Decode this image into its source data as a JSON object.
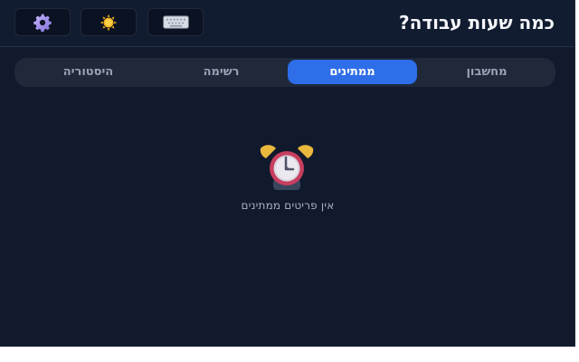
{
  "header": {
    "title": "כמה שעות עבודה?",
    "buttons": [
      {
        "name": "settings",
        "icon": "gear-icon"
      },
      {
        "name": "theme",
        "icon": "sun-icon"
      },
      {
        "name": "keyboard",
        "icon": "keyboard-icon"
      }
    ]
  },
  "tabs": [
    {
      "id": "calculator",
      "label": "מחשבון",
      "active": false
    },
    {
      "id": "pending",
      "label": "ממתינים",
      "active": true
    },
    {
      "id": "list",
      "label": "רשימה",
      "active": false
    },
    {
      "id": "history",
      "label": "היסטוריה",
      "active": false
    }
  ],
  "empty_state": {
    "icon": "alarm-clock-icon",
    "message": "אין פריטים ממתינים"
  },
  "colors": {
    "background": "#111a2d",
    "header_background": "#121c30",
    "accent": "#2f6ee9",
    "tab_strip": "#1f293a",
    "text_primary": "#f5f7fb",
    "text_muted": "#9aa3b6"
  }
}
